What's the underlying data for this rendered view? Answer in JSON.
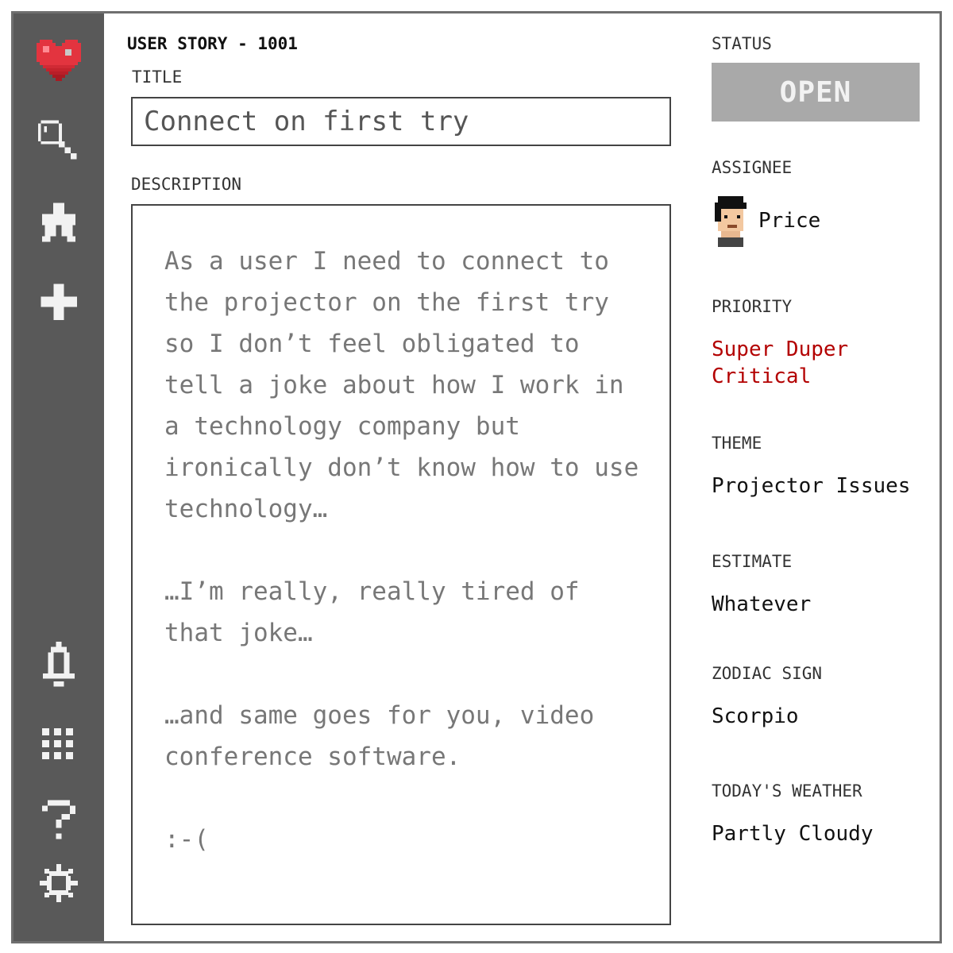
{
  "story": {
    "id_label": "USER STORY - 1001",
    "title_label": "TITLE",
    "title_value": "Connect on first try",
    "description_label": "DESCRIPTION",
    "description": {
      "p1": "As a user I need to connect to the projector on the first try so I don’t feel obligated to tell a joke about how I work in a technology company but ironically don’t know how to use technology…",
      "p2": "…I’m really, really tired of that joke…",
      "p3": "…and same goes for you, video conference software.",
      "p4": ":-("
    }
  },
  "details": {
    "status_label": "STATUS",
    "status_value": "OPEN",
    "assignee_label": "ASSIGNEE",
    "assignee_name": "Price",
    "priority_label": "PRIORITY",
    "priority_value": "Super Duper Critical",
    "theme_label": "THEME",
    "theme_value": "Projector Issues",
    "estimate_label": "ESTIMATE",
    "estimate_value": "Whatever",
    "zodiac_label": "ZODIAC SIGN",
    "zodiac_value": "Scorpio",
    "weather_label": "TODAY'S WEATHER",
    "weather_value": "Partly Cloudy"
  },
  "sidebar": {
    "icons": [
      "heart-logo-icon",
      "search-icon",
      "puzzle-icon",
      "plus-icon",
      "bell-icon",
      "grid-icon",
      "help-icon",
      "gear-icon"
    ]
  },
  "colors": {
    "sidebar_bg": "#595959",
    "status_bg": "#a9a9a9",
    "priority_text": "#b30000",
    "heart": "#e3343f"
  }
}
